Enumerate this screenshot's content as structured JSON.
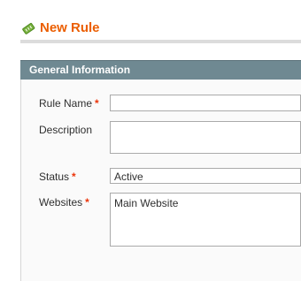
{
  "header": {
    "icon": "new-rule-icon",
    "title": "New Rule",
    "accent_color": "#eb5e00"
  },
  "fieldset": {
    "title": "General Information",
    "header_color": "#6f8992"
  },
  "form": {
    "rule_name": {
      "label": "Rule Name",
      "required_mark": "*",
      "value": ""
    },
    "description": {
      "label": "Description",
      "value": ""
    },
    "status": {
      "label": "Status",
      "required_mark": "*",
      "selected": "Active"
    },
    "websites": {
      "label": "Websites",
      "required_mark": "*",
      "options": [
        "Main Website"
      ]
    }
  }
}
